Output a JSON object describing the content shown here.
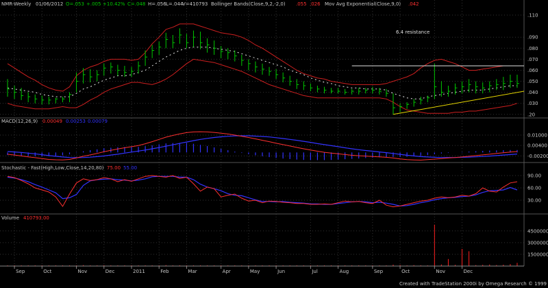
{
  "header": {
    "symbol": "NMR-Weekly",
    "date": "01/06/2012",
    "open": "O=.053",
    "change": "+.005",
    "high_pct": "H=.056",
    "change_pct": "+10.42%",
    "low": "L=.044",
    "close": "C=.048",
    "volume": "V=410793"
  },
  "colors": {
    "background": "#000000",
    "price_up": "#00c800",
    "bands": "#cc1f1f",
    "ema": "#e6e6e6",
    "macd": "#ff3030",
    "signal": "#3333ff",
    "histogram": "#3333ff",
    "stoch_k": "#ff3030",
    "stoch_d": "#3333ff",
    "volume": "#ff2020",
    "grid": "#333333",
    "trendline": "#e8d800",
    "text": "#c8c8c8"
  },
  "chart_data": [
    {
      "type": "line",
      "panel": "price",
      "legend": {
        "bollinger": "Bollinger Bands(Close,9,2,-2,0)",
        "bollinger_vals": [
          ".055",
          ".026"
        ],
        "ema": "Mov Avg Exponential(Close,9,0)",
        "ema_val": ".042"
      },
      "yticks": [
        ".110",
        ".090",
        ".080",
        ".070",
        ".060",
        ".050",
        ".040",
        ".030",
        ".20"
      ],
      "ylim": [
        0.018,
        0.115
      ],
      "annotation": "6.4 resistance",
      "resistance": 0.064,
      "trendline": [
        [
          56,
          0.02
        ],
        [
          75,
          0.041
        ]
      ],
      "bars": [
        {
          "h": 0.052,
          "l": 0.036,
          "c": 0.043
        },
        {
          "h": 0.046,
          "l": 0.034,
          "c": 0.04
        },
        {
          "h": 0.044,
          "l": 0.033,
          "c": 0.037
        },
        {
          "h": 0.04,
          "l": 0.031,
          "c": 0.036
        },
        {
          "h": 0.038,
          "l": 0.03,
          "c": 0.034
        },
        {
          "h": 0.037,
          "l": 0.029,
          "c": 0.033
        },
        {
          "h": 0.036,
          "l": 0.029,
          "c": 0.033
        },
        {
          "h": 0.035,
          "l": 0.03,
          "c": 0.034
        },
        {
          "h": 0.036,
          "l": 0.031,
          "c": 0.034
        },
        {
          "h": 0.04,
          "l": 0.031,
          "c": 0.038
        },
        {
          "h": 0.058,
          "l": 0.04,
          "c": 0.05
        },
        {
          "h": 0.062,
          "l": 0.048,
          "c": 0.056
        },
        {
          "h": 0.061,
          "l": 0.049,
          "c": 0.054
        },
        {
          "h": 0.06,
          "l": 0.05,
          "c": 0.056
        },
        {
          "h": 0.066,
          "l": 0.055,
          "c": 0.062
        },
        {
          "h": 0.067,
          "l": 0.057,
          "c": 0.063
        },
        {
          "h": 0.065,
          "l": 0.055,
          "c": 0.06
        },
        {
          "h": 0.064,
          "l": 0.054,
          "c": 0.058
        },
        {
          "h": 0.063,
          "l": 0.054,
          "c": 0.059
        },
        {
          "h": 0.068,
          "l": 0.057,
          "c": 0.064
        },
        {
          "h": 0.078,
          "l": 0.064,
          "c": 0.072
        },
        {
          "h": 0.083,
          "l": 0.071,
          "c": 0.078
        },
        {
          "h": 0.086,
          "l": 0.074,
          "c": 0.081
        },
        {
          "h": 0.094,
          "l": 0.08,
          "c": 0.088
        },
        {
          "h": 0.092,
          "l": 0.08,
          "c": 0.085
        },
        {
          "h": 0.098,
          "l": 0.084,
          "c": 0.092
        },
        {
          "h": 0.093,
          "l": 0.08,
          "c": 0.085
        },
        {
          "h": 0.096,
          "l": 0.081,
          "c": 0.09
        },
        {
          "h": 0.095,
          "l": 0.079,
          "c": 0.085
        },
        {
          "h": 0.089,
          "l": 0.076,
          "c": 0.083
        },
        {
          "h": 0.087,
          "l": 0.074,
          "c": 0.08
        },
        {
          "h": 0.082,
          "l": 0.071,
          "c": 0.077
        },
        {
          "h": 0.08,
          "l": 0.07,
          "c": 0.076
        },
        {
          "h": 0.078,
          "l": 0.068,
          "c": 0.073
        },
        {
          "h": 0.074,
          "l": 0.064,
          "c": 0.069
        },
        {
          "h": 0.07,
          "l": 0.06,
          "c": 0.066
        },
        {
          "h": 0.068,
          "l": 0.058,
          "c": 0.063
        },
        {
          "h": 0.066,
          "l": 0.056,
          "c": 0.061
        },
        {
          "h": 0.063,
          "l": 0.055,
          "c": 0.059
        },
        {
          "h": 0.061,
          "l": 0.052,
          "c": 0.056
        },
        {
          "h": 0.058,
          "l": 0.049,
          "c": 0.053
        },
        {
          "h": 0.055,
          "l": 0.046,
          "c": 0.05
        },
        {
          "h": 0.052,
          "l": 0.043,
          "c": 0.047
        },
        {
          "h": 0.05,
          "l": 0.042,
          "c": 0.046
        },
        {
          "h": 0.048,
          "l": 0.041,
          "c": 0.044
        },
        {
          "h": 0.046,
          "l": 0.04,
          "c": 0.043
        },
        {
          "h": 0.045,
          "l": 0.039,
          "c": 0.042
        },
        {
          "h": 0.044,
          "l": 0.039,
          "c": 0.041
        },
        {
          "h": 0.044,
          "l": 0.039,
          "c": 0.041
        },
        {
          "h": 0.043,
          "l": 0.038,
          "c": 0.04
        },
        {
          "h": 0.043,
          "l": 0.038,
          "c": 0.041
        },
        {
          "h": 0.044,
          "l": 0.038,
          "c": 0.041
        },
        {
          "h": 0.044,
          "l": 0.039,
          "c": 0.042
        },
        {
          "h": 0.045,
          "l": 0.039,
          "c": 0.042
        },
        {
          "h": 0.044,
          "l": 0.038,
          "c": 0.041
        },
        {
          "h": 0.043,
          "l": 0.036,
          "c": 0.039
        },
        {
          "h": 0.039,
          "l": 0.02,
          "c": 0.026
        },
        {
          "h": 0.03,
          "l": 0.022,
          "c": 0.027
        },
        {
          "h": 0.031,
          "l": 0.025,
          "c": 0.029
        },
        {
          "h": 0.034,
          "l": 0.027,
          "c": 0.031
        },
        {
          "h": 0.036,
          "l": 0.029,
          "c": 0.033
        },
        {
          "h": 0.037,
          "l": 0.031,
          "c": 0.035
        },
        {
          "h": 0.066,
          "l": 0.034,
          "c": 0.045
        },
        {
          "h": 0.05,
          "l": 0.036,
          "c": 0.04
        },
        {
          "h": 0.046,
          "l": 0.036,
          "c": 0.041
        },
        {
          "h": 0.048,
          "l": 0.038,
          "c": 0.044
        },
        {
          "h": 0.05,
          "l": 0.039,
          "c": 0.045
        },
        {
          "h": 0.052,
          "l": 0.04,
          "c": 0.047
        },
        {
          "h": 0.05,
          "l": 0.039,
          "c": 0.045
        },
        {
          "h": 0.049,
          "l": 0.039,
          "c": 0.044
        },
        {
          "h": 0.05,
          "l": 0.04,
          "c": 0.046
        },
        {
          "h": 0.052,
          "l": 0.042,
          "c": 0.047
        },
        {
          "h": 0.054,
          "l": 0.042,
          "c": 0.048
        },
        {
          "h": 0.056,
          "l": 0.044,
          "c": 0.05
        },
        {
          "h": 0.056,
          "l": 0.044,
          "c": 0.048
        }
      ],
      "upper_band": [
        0.066,
        0.062,
        0.058,
        0.054,
        0.051,
        0.047,
        0.044,
        0.042,
        0.041,
        0.045,
        0.055,
        0.06,
        0.063,
        0.065,
        0.068,
        0.07,
        0.07,
        0.07,
        0.069,
        0.07,
        0.076,
        0.084,
        0.09,
        0.097,
        0.099,
        0.102,
        0.102,
        0.102,
        0.1,
        0.098,
        0.096,
        0.094,
        0.093,
        0.092,
        0.09,
        0.087,
        0.083,
        0.08,
        0.076,
        0.072,
        0.068,
        0.064,
        0.06,
        0.057,
        0.055,
        0.053,
        0.052,
        0.05,
        0.049,
        0.048,
        0.047,
        0.047,
        0.047,
        0.047,
        0.047,
        0.048,
        0.05,
        0.052,
        0.054,
        0.057,
        0.062,
        0.066,
        0.069,
        0.07,
        0.068,
        0.066,
        0.063,
        0.06,
        0.06,
        0.061,
        0.062,
        0.063,
        0.064,
        0.064,
        0.064
      ],
      "lower_band": [
        0.03,
        0.028,
        0.027,
        0.026,
        0.025,
        0.025,
        0.025,
        0.026,
        0.027,
        0.026,
        0.026,
        0.029,
        0.033,
        0.036,
        0.04,
        0.043,
        0.045,
        0.047,
        0.049,
        0.049,
        0.048,
        0.047,
        0.049,
        0.052,
        0.056,
        0.061,
        0.066,
        0.07,
        0.069,
        0.068,
        0.067,
        0.065,
        0.063,
        0.061,
        0.059,
        0.056,
        0.053,
        0.05,
        0.047,
        0.045,
        0.043,
        0.041,
        0.039,
        0.037,
        0.036,
        0.035,
        0.035,
        0.035,
        0.035,
        0.035,
        0.035,
        0.035,
        0.035,
        0.035,
        0.035,
        0.034,
        0.031,
        0.027,
        0.024,
        0.023,
        0.022,
        0.021,
        0.021,
        0.021,
        0.021,
        0.022,
        0.022,
        0.023,
        0.023,
        0.024,
        0.025,
        0.026,
        0.027,
        0.028,
        0.03
      ],
      "ema": [
        0.044,
        0.043,
        0.042,
        0.041,
        0.04,
        0.038,
        0.037,
        0.036,
        0.036,
        0.036,
        0.039,
        0.043,
        0.045,
        0.048,
        0.051,
        0.053,
        0.055,
        0.055,
        0.056,
        0.058,
        0.06,
        0.064,
        0.068,
        0.072,
        0.075,
        0.078,
        0.08,
        0.081,
        0.081,
        0.081,
        0.08,
        0.079,
        0.078,
        0.077,
        0.075,
        0.073,
        0.071,
        0.069,
        0.067,
        0.065,
        0.063,
        0.06,
        0.058,
        0.056,
        0.053,
        0.051,
        0.049,
        0.048,
        0.046,
        0.045,
        0.044,
        0.044,
        0.043,
        0.043,
        0.043,
        0.042,
        0.039,
        0.037,
        0.035,
        0.034,
        0.034,
        0.036,
        0.037,
        0.038,
        0.039,
        0.04,
        0.041,
        0.042,
        0.042,
        0.042,
        0.043,
        0.044,
        0.045,
        0.046,
        0.046
      ],
      "series": [
        {
          "name": "Bollinger Bands(Close,9,2,-2,0)"
        },
        {
          "name": "Mov Avg Exponential(Close,9,0)"
        }
      ]
    },
    {
      "type": "line",
      "panel": "macd",
      "label": "MACD(12,26,9)",
      "readout": [
        "0.00049",
        "0.00253",
        "0.00079"
      ],
      "yticks": [
        "0.01000",
        "0.00400",
        "-0.00200"
      ],
      "ylim": [
        -0.005,
        0.0155
      ],
      "series": [
        {
          "name": "MACD",
          "values": [
            -0.001,
            -0.0015,
            -0.002,
            -0.0025,
            -0.003,
            -0.0035,
            -0.004,
            -0.0042,
            -0.0043,
            -0.004,
            -0.0032,
            -0.0022,
            -0.0014,
            -0.0006,
            0.0004,
            0.0012,
            0.002,
            0.0027,
            0.0033,
            0.004,
            0.005,
            0.0062,
            0.0075,
            0.0088,
            0.0098,
            0.0107,
            0.0114,
            0.0118,
            0.0119,
            0.0118,
            0.0115,
            0.0111,
            0.0106,
            0.01,
            0.0093,
            0.0086,
            0.0078,
            0.007,
            0.0062,
            0.0053,
            0.0045,
            0.0037,
            0.0029,
            0.0021,
            0.0014,
            0.0007,
            0.0001,
            -0.0004,
            -0.0008,
            -0.0012,
            -0.0016,
            -0.0019,
            -0.0021,
            -0.0023,
            -0.0025,
            -0.0028,
            -0.0032,
            -0.0037,
            -0.0041,
            -0.0043,
            -0.0044,
            -0.0041,
            -0.0038,
            -0.0035,
            -0.0032,
            -0.0029,
            -0.0026,
            -0.0022,
            -0.0018,
            -0.0014,
            -0.001,
            -0.0006,
            -0.0002,
            0.0002,
            0.0005
          ]
        },
        {
          "name": "Signal",
          "values": [
            0.0005,
            0.0003,
            0.0,
            -0.0004,
            -0.0008,
            -0.0013,
            -0.0018,
            -0.0022,
            -0.0026,
            -0.0029,
            -0.003,
            -0.0029,
            -0.0027,
            -0.0024,
            -0.002,
            -0.0015,
            -0.001,
            -0.0004,
            0.0002,
            0.0008,
            0.0014,
            0.0021,
            0.0028,
            0.0036,
            0.0044,
            0.0052,
            0.006,
            0.0068,
            0.0075,
            0.0081,
            0.0086,
            0.009,
            0.0093,
            0.0095,
            0.0096,
            0.0096,
            0.0094,
            0.0092,
            0.0089,
            0.0085,
            0.008,
            0.0075,
            0.007,
            0.0064,
            0.0058,
            0.0051,
            0.0045,
            0.0039,
            0.0033,
            0.0027,
            0.0021,
            0.0016,
            0.0011,
            0.0007,
            0.0003,
            -0.0001,
            -0.0006,
            -0.0011,
            -0.0016,
            -0.002,
            -0.0024,
            -0.0026,
            -0.0028,
            -0.0029,
            -0.0029,
            -0.0029,
            -0.0028,
            -0.0027,
            -0.0025,
            -0.0023,
            -0.0021,
            -0.0018,
            -0.0015,
            -0.0012,
            -0.0009
          ]
        }
      ]
    },
    {
      "type": "line",
      "panel": "stochastic",
      "label": "Stochastic - Fast(High,Low,Close,14,20,80)",
      "readout": [
        "75.00",
        "55.00"
      ],
      "yticks": [
        "90.00",
        "60.00",
        "30.00"
      ],
      "ylim": [
        0,
        100
      ],
      "series": [
        {
          "name": "%K",
          "values": [
            88,
            85,
            78,
            70,
            60,
            55,
            50,
            38,
            15,
            45,
            72,
            82,
            78,
            80,
            85,
            82,
            75,
            80,
            76,
            82,
            88,
            90,
            88,
            86,
            90,
            83,
            86,
            70,
            52,
            62,
            58,
            38,
            42,
            45,
            35,
            28,
            30,
            24,
            28,
            27,
            25,
            24,
            22,
            22,
            20,
            20,
            21,
            20,
            24,
            28,
            26,
            27,
            24,
            22,
            30,
            18,
            14,
            16,
            20,
            24,
            28,
            30,
            35,
            38,
            36,
            38,
            42,
            40,
            46,
            60,
            52,
            50,
            62,
            72,
            75
          ]
        },
        {
          "name": "%D",
          "values": [
            86,
            84,
            80,
            75,
            68,
            62,
            55,
            48,
            34,
            36,
            44,
            66,
            77,
            80,
            81,
            82,
            80,
            79,
            77,
            79,
            82,
            87,
            88,
            88,
            88,
            86,
            86,
            80,
            69,
            62,
            58,
            53,
            46,
            42,
            41,
            36,
            31,
            27,
            27,
            26,
            27,
            25,
            24,
            23,
            21,
            21,
            20,
            20,
            22,
            24,
            26,
            27,
            26,
            24,
            25,
            23,
            20,
            16,
            17,
            20,
            24,
            27,
            31,
            34,
            36,
            37,
            39,
            40,
            43,
            49,
            53,
            54,
            55,
            61,
            55
          ]
        }
      ]
    },
    {
      "type": "bar",
      "panel": "volume",
      "label": "Volume",
      "readout": "410793.00",
      "yticks": [
        "4500000",
        "3000000",
        "1500000"
      ],
      "ylim": [
        0,
        5800000
      ],
      "values": [
        80000,
        60000,
        50000,
        70000,
        90000,
        40000,
        60000,
        50000,
        70000,
        80000,
        60000,
        120000,
        90000,
        60000,
        110000,
        70000,
        60000,
        50000,
        40000,
        80000,
        90000,
        60000,
        70000,
        120000,
        80000,
        100000,
        70000,
        60000,
        90000,
        80000,
        50000,
        60000,
        70000,
        50000,
        40000,
        60000,
        80000,
        50000,
        40000,
        60000,
        70000,
        60000,
        50000,
        40000,
        60000,
        50000,
        40000,
        50000,
        30000,
        40000,
        50000,
        60000,
        50000,
        40000,
        50000,
        60000,
        180000,
        150000,
        90000,
        120000,
        100000,
        80000,
        5300000,
        200000,
        900000,
        150000,
        2200000,
        1900000,
        120000,
        160000,
        200000,
        130000,
        170000,
        250000,
        410793
      ]
    }
  ],
  "xaxis": {
    "labels": [
      "Sep",
      "Oct",
      "Nov",
      "Dec",
      "2011",
      "Feb",
      "Mar",
      "Apr",
      "May",
      "Jun",
      "Jul",
      "Aug",
      "Sep",
      "Oct",
      "Nov",
      "Dec"
    ]
  },
  "footer": "Created with TradeStation 2000i by Omega Research © 1999"
}
